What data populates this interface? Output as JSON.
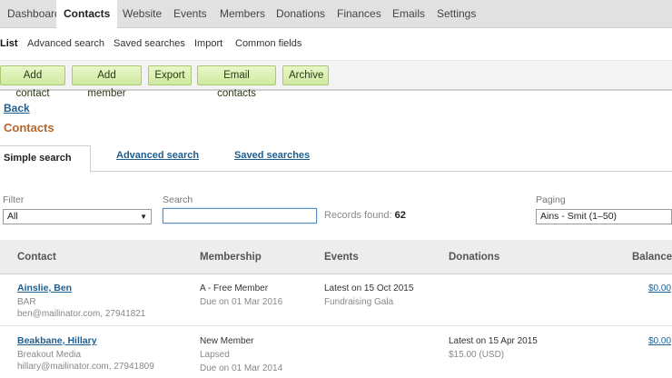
{
  "topnav": {
    "tabs": [
      {
        "label": "Dashboard",
        "active": false
      },
      {
        "label": "Contacts",
        "active": true
      },
      {
        "label": "Website",
        "active": false
      },
      {
        "label": "Events",
        "active": false
      },
      {
        "label": "Members",
        "active": false
      },
      {
        "label": "Donations",
        "active": false
      },
      {
        "label": "Finances",
        "active": false
      },
      {
        "label": "Emails",
        "active": false
      },
      {
        "label": "Settings",
        "active": false
      }
    ]
  },
  "subnav": {
    "items": [
      {
        "label": "List",
        "active": true
      },
      {
        "label": "Advanced search",
        "active": false
      },
      {
        "label": "Saved searches",
        "active": false
      },
      {
        "label": "Import",
        "active": false
      },
      {
        "label": "Common fields",
        "active": false
      }
    ]
  },
  "toolbar": {
    "buttons": [
      "Add contact",
      "Add member",
      "Export",
      "Email contacts",
      "Archive"
    ]
  },
  "back_label": "Back",
  "page_title": "Contacts",
  "search_tabs": {
    "active": "Simple search",
    "others": [
      "Advanced search",
      "Saved searches"
    ]
  },
  "filter": {
    "label": "Filter",
    "value": "All"
  },
  "search": {
    "label": "Search",
    "value": ""
  },
  "records": {
    "label": "Records found:",
    "count": "62"
  },
  "paging": {
    "label": "Paging",
    "value": "Ains - Smit (1–50)"
  },
  "table": {
    "headers": [
      "Contact",
      "Membership",
      "Events",
      "Donations",
      "Balance"
    ],
    "rows": [
      {
        "name": "Ainslie, Ben",
        "org": "BAR",
        "email": "ben@mailinator.com, 27941821",
        "membership": "A - Free Member",
        "membership_status": "",
        "membership_due": "Due on 01 Mar 2016",
        "events_latest": "Latest on 15 Oct 2015",
        "events_name": "Fundraising Gala",
        "donations_latest": "",
        "donations_amount": "",
        "balance": "$0.00"
      },
      {
        "name": "Beakbane, Hillary",
        "org": "Breakout Media",
        "email": "hillary@mailinator.com, 27941809",
        "membership": "New Member",
        "membership_status": "Lapsed",
        "membership_due": "Due on 01 Mar 2014",
        "events_latest": "",
        "events_name": "",
        "donations_latest": "Latest on 15 Apr 2015",
        "donations_amount": "$15.00 (USD)",
        "balance": "$0.00"
      }
    ]
  }
}
